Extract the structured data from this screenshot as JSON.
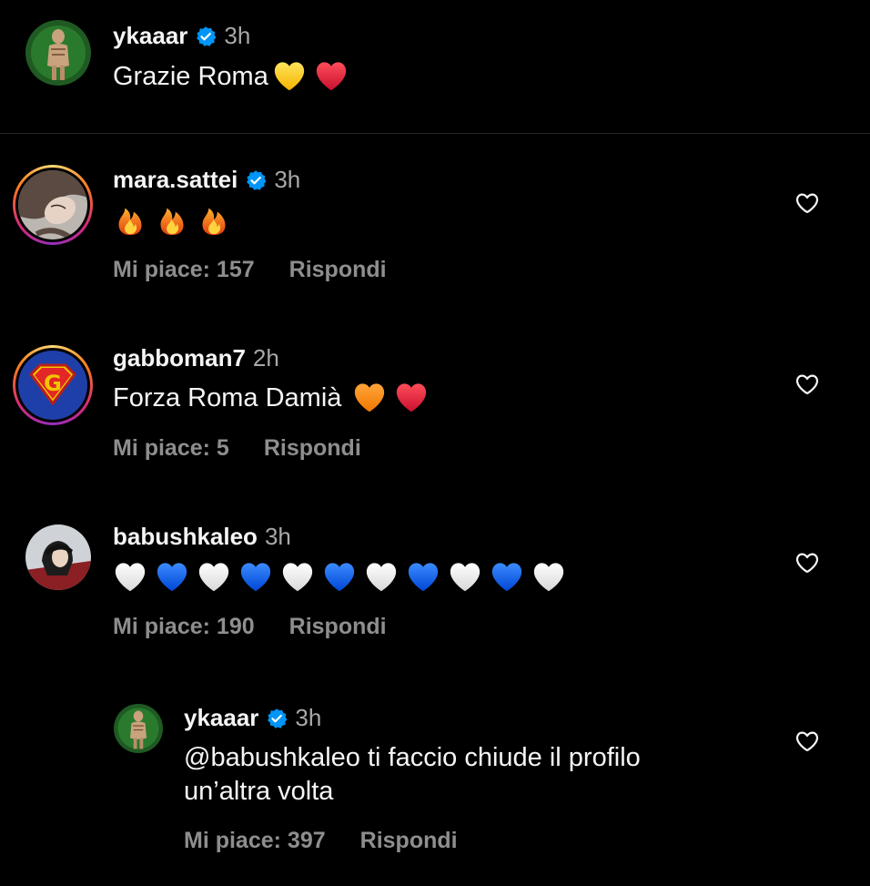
{
  "caption": {
    "username": "ykaaar",
    "time": "3h",
    "text": "Grazie Roma",
    "emojis": [
      "yellow-heart",
      "red-heart"
    ]
  },
  "comments": [
    {
      "username": "mara.sattei",
      "verified": true,
      "time": "3h",
      "text": "",
      "emojis": [
        "fire",
        "fire",
        "fire"
      ],
      "likes_label": "Mi piace: 157",
      "reply_label": "Rispondi"
    },
    {
      "username": "gabboman7",
      "verified": false,
      "time": "2h",
      "text": "Forza Roma Damià",
      "emojis": [
        "orange-heart",
        "red-heart"
      ],
      "likes_label": "Mi piace: 5",
      "reply_label": "Rispondi"
    },
    {
      "username": "babushkaleo",
      "verified": false,
      "time": "3h",
      "text": "",
      "emojis": [
        "white-heart",
        "blue-heart",
        "white-heart",
        "blue-heart",
        "white-heart",
        "blue-heart",
        "white-heart",
        "blue-heart",
        "white-heart",
        "blue-heart",
        "white-heart"
      ],
      "likes_label": "Mi piace: 190",
      "reply_label": "Rispondi"
    }
  ],
  "reply": {
    "username": "ykaaar",
    "verified": true,
    "time": "3h",
    "text_line1": "@babushkaleo ti faccio chiude il profilo",
    "text_line2": "un’altra volta",
    "likes_label": "Mi piace: 397",
    "reply_label": "Rispondi"
  },
  "colors": {
    "background": "#000000",
    "text": "#f5f5f5",
    "secondary": "#a8a8a8",
    "actions": "#8e8e8e",
    "verified": "#0095f6",
    "divider": "#262626"
  },
  "icons": {
    "verified": "verified-badge-icon",
    "like": "heart-outline-icon"
  }
}
